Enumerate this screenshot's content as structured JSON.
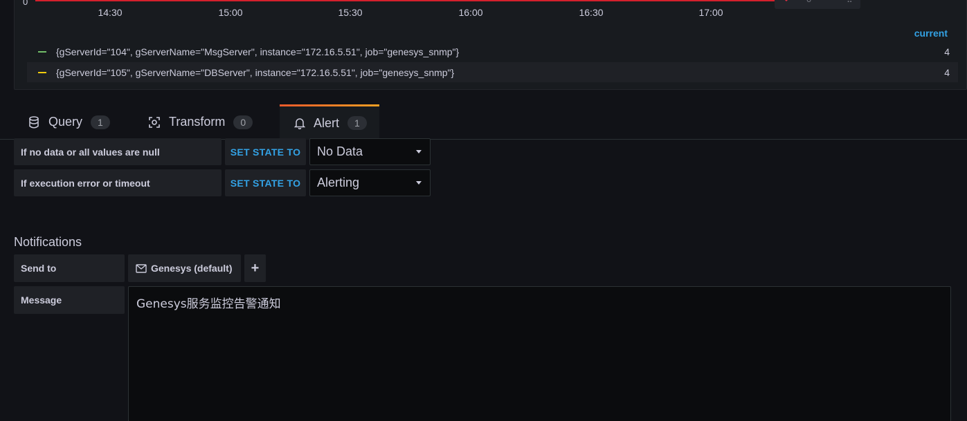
{
  "graph": {
    "y_zero": "0",
    "x_ticks": [
      "14:30",
      "15:00",
      "15:30",
      "16:00",
      "16:30",
      "17:00"
    ],
    "threshold_color": "#d4202c",
    "overlay_value": "0"
  },
  "legend": {
    "header": "current",
    "series": [
      {
        "name": "{gServerId=\"104\", gServerName=\"MsgServer\", instance=\"172.16.5.51\", job=\"genesys_snmp\"}",
        "value": "4",
        "color": "#73bf69"
      },
      {
        "name": "{gServerId=\"105\", gServerName=\"DBServer\", instance=\"172.16.5.51\", job=\"genesys_snmp\"}",
        "value": "4",
        "color": "#f2cc0c"
      }
    ]
  },
  "tabs": [
    {
      "label": "Query",
      "count": "1",
      "icon": "database-icon"
    },
    {
      "label": "Transform",
      "count": "0",
      "icon": "transform-icon"
    },
    {
      "label": "Alert",
      "count": "1",
      "icon": "bell-icon",
      "active": true
    }
  ],
  "alert": {
    "no_data": {
      "label": "If no data or all values are null",
      "keyword": "SET STATE TO",
      "value": "No Data"
    },
    "exec_error": {
      "label": "If execution error or timeout",
      "keyword": "SET STATE TO",
      "value": "Alerting"
    }
  },
  "notifications": {
    "title": "Notifications",
    "send_to_label": "Send to",
    "notifier": "Genesys (default)",
    "add_label": "+",
    "message_label": "Message",
    "message_value": "Genesys服务监控告警通知"
  }
}
